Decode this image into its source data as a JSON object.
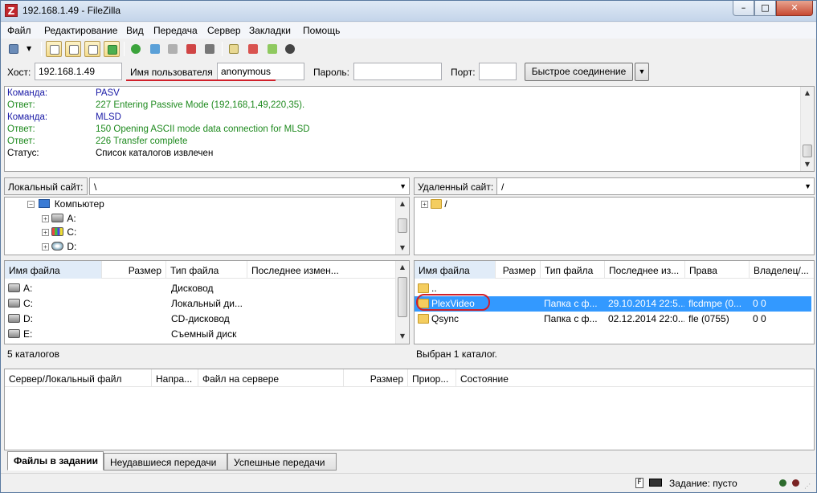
{
  "window": {
    "title": "192.168.1.49 - FileZilla",
    "app_icon": "filezilla-icon",
    "minimize": "–",
    "maximize": "□",
    "close": "✕"
  },
  "menu": [
    "Файл",
    "Редактирование",
    "Вид",
    "Передача",
    "Сервер",
    "Закладки",
    "Помощь"
  ],
  "quickconnect": {
    "host_label": "Хост:",
    "host_value": "192.168.1.49",
    "user_label": "Имя пользователя",
    "user_value": "anonymous",
    "pass_label": "Пароль:",
    "pass_value": "",
    "port_label": "Порт:",
    "port_value": "",
    "button": "Быстрое соединение",
    "dropdown": "▼"
  },
  "log": [
    {
      "key": "Команда:",
      "value": "PASV",
      "color": "#1a1aa6"
    },
    {
      "key": "Ответ:",
      "value": "227 Entering Passive Mode (192,168,1,49,220,35).",
      "color": "#1e8a1e"
    },
    {
      "key": "Команда:",
      "value": "MLSD",
      "color": "#1a1aa6"
    },
    {
      "key": "Ответ:",
      "value": "150 Opening ASCII mode data connection for MLSD",
      "color": "#1e8a1e"
    },
    {
      "key": "Ответ:",
      "value": "226 Transfer complete",
      "color": "#1e8a1e"
    },
    {
      "key": "Статус:",
      "value": "Список каталогов извлечен",
      "color": "#000000"
    }
  ],
  "local": {
    "site_label": "Локальный сайт:",
    "path": "\\",
    "tree": {
      "root": "Компьютер",
      "drives": [
        "A:",
        "C:",
        "D:"
      ]
    },
    "columns": [
      "Имя файла",
      "Размер",
      "Тип файла",
      "Последнее измен..."
    ],
    "files": [
      {
        "name": "A:",
        "size": "",
        "type": "Дисковод",
        "modified": ""
      },
      {
        "name": "C:",
        "size": "",
        "type": "Локальный ди...",
        "modified": ""
      },
      {
        "name": "D:",
        "size": "",
        "type": "CD-дисковод",
        "modified": ""
      },
      {
        "name": "E:",
        "size": "",
        "type": "Съемный диск",
        "modified": ""
      }
    ],
    "status": "5 каталогов"
  },
  "remote": {
    "site_label": "Удаленный сайт:",
    "path": "/",
    "tree": {
      "root": "/"
    },
    "columns": [
      "Имя файла",
      "Размер",
      "Тип файла",
      "Последнее из...",
      "Права",
      "Владелец/..."
    ],
    "files": [
      {
        "name": "..",
        "size": "",
        "type": "",
        "modified": "",
        "perms": "",
        "owner": "",
        "selected": false
      },
      {
        "name": "PlexVideo",
        "size": "",
        "type": "Папка с ф...",
        "modified": "29.10.2014 22:5...",
        "perms": "flcdmpe (0...",
        "owner": "0 0",
        "selected": true
      },
      {
        "name": "Qsync",
        "size": "",
        "type": "Папка с ф...",
        "modified": "02.12.2014 22:0...",
        "perms": "fle (0755)",
        "owner": "0 0",
        "selected": false
      }
    ],
    "status": "Выбран 1 каталог."
  },
  "queue": {
    "columns": [
      "Сервер/Локальный файл",
      "Напра...",
      "Файл на сервере",
      "Размер",
      "Приор...",
      "Состояние"
    ]
  },
  "tabs": [
    "Файлы в задании",
    "Неудавшиеся передачи",
    "Успешные передачи"
  ],
  "statusbar": {
    "queue": "Задание: пусто"
  },
  "colors": {
    "selection": "#3399ff",
    "annotation": "#d0202a"
  }
}
